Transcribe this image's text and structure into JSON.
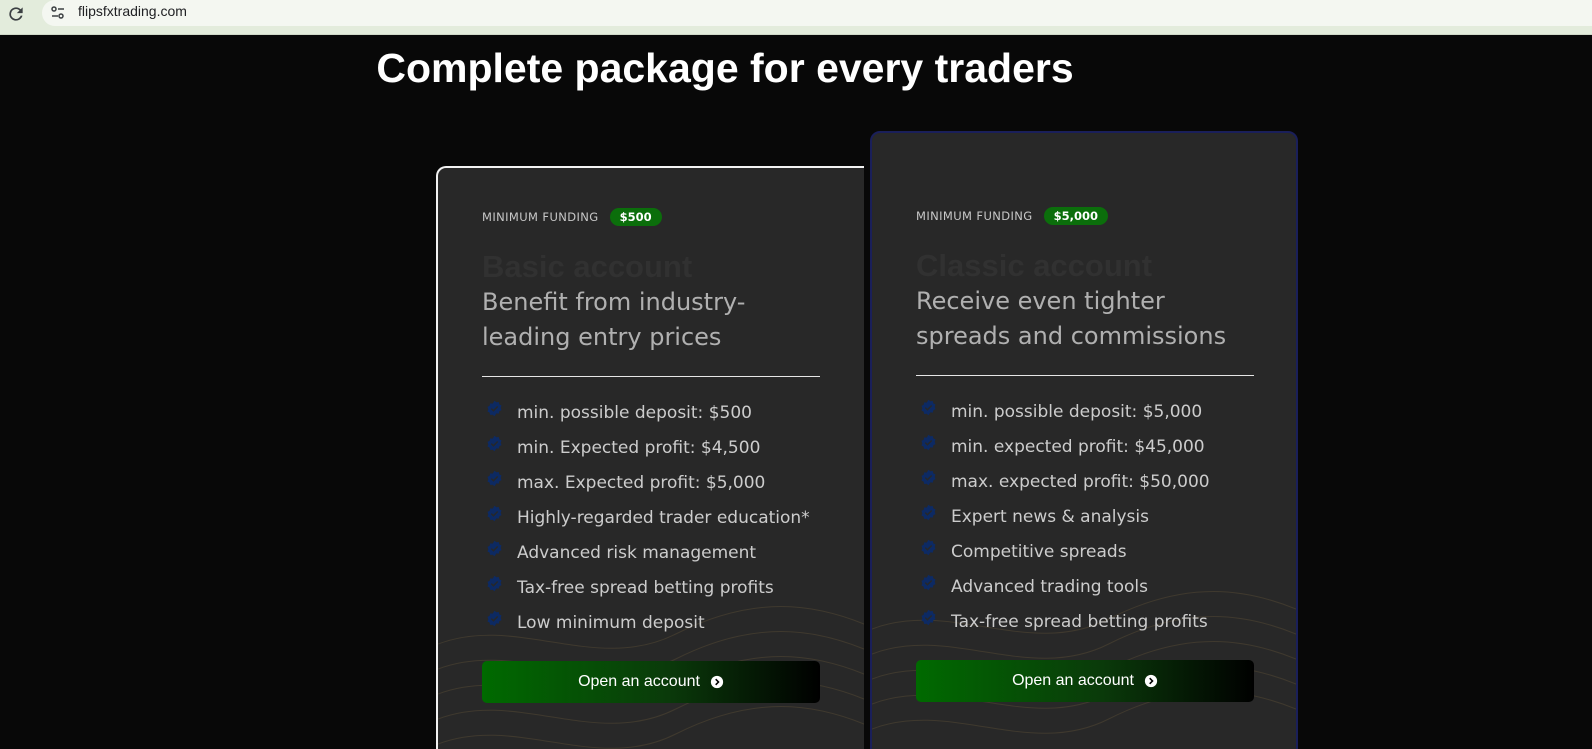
{
  "browser": {
    "url": "flipsfxtrading.com"
  },
  "section": {
    "headline": "Complete package for every traders"
  },
  "cards": [
    {
      "funding_label": "MINIMUM FUNDING",
      "funding_amount": "$500",
      "name": "Basic account",
      "description": "Benefit from industry-leading entry prices",
      "features": [
        "min. possible deposit: $500",
        "min. Expected profit: $4,500",
        "max. Expected profit: $5,000",
        "Highly-regarded trader education*",
        "Advanced risk management",
        "Tax-free spread betting profits",
        "Low minimum deposit"
      ],
      "cta_label": "Open an account"
    },
    {
      "funding_label": "MINIMUM FUNDING",
      "funding_amount": "$5,000",
      "name": "Classic account",
      "description": "Receive even tighter spreads and commissions",
      "features": [
        "min. possible deposit: $5,000",
        "min. expected profit: $45,000",
        "max. expected profit: $50,000",
        "Expert news & analysis",
        "Competitive spreads",
        "Advanced trading tools",
        "Tax-free spread betting profits"
      ],
      "cta_label": "Open an account"
    }
  ],
  "colors": {
    "accent_green": "#0b6e0b",
    "check_blue": "#0d2a63",
    "card_bg": "#282828",
    "page_bg": "#080808"
  },
  "icons": {
    "reload": "reload-icon",
    "site_settings": "tune-icon",
    "feature_check": "check-icon",
    "cta_arrow": "arrow-circle-icon"
  }
}
